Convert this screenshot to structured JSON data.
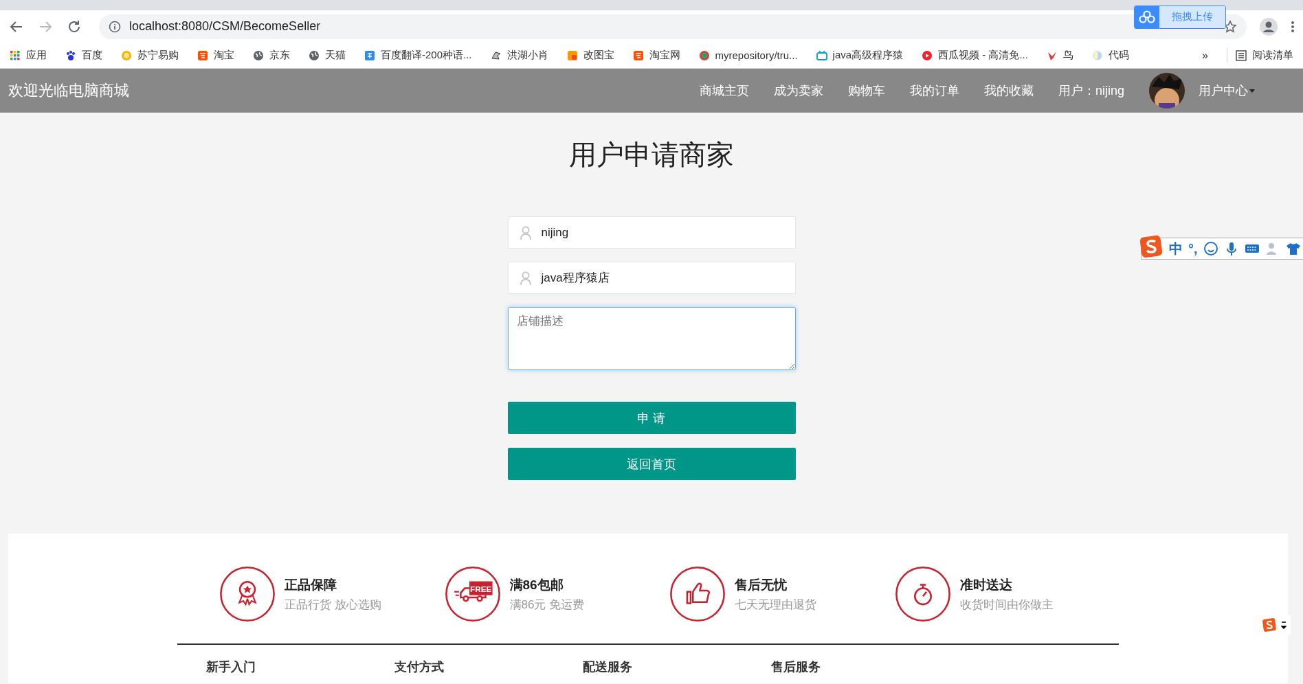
{
  "browser": {
    "address": "localhost:8080/CSM/BecomeSeller",
    "upload_button": "拖拽上传",
    "bookmarks": [
      {
        "label": "应用",
        "kind": "apps"
      },
      {
        "label": "百度",
        "kind": "paw"
      },
      {
        "label": "苏宁易购",
        "kind": "lion"
      },
      {
        "label": "淘宝",
        "kind": "tao"
      },
      {
        "label": "京东",
        "kind": "globe"
      },
      {
        "label": "天猫",
        "kind": "globe"
      },
      {
        "label": "百度翻译-200种语...",
        "kind": "translate"
      },
      {
        "label": "洪湖小肖",
        "kind": "bird"
      },
      {
        "label": "改图宝",
        "kind": "square"
      },
      {
        "label": "淘宝网",
        "kind": "tao"
      },
      {
        "label": "myrepository/tru...",
        "kind": "swirl"
      },
      {
        "label": "java高级程序猿",
        "kind": "tv"
      },
      {
        "label": "西瓜视频 - 高清免...",
        "kind": "play"
      },
      {
        "label": "鸟",
        "kind": "bird2"
      },
      {
        "label": "代码",
        "kind": "moon"
      }
    ],
    "more": "»",
    "reading_list": "阅读清单"
  },
  "navbar": {
    "brand": "欢迎光临电脑商城",
    "links": [
      "商城主页",
      "成为卖家",
      "购物车",
      "我的订单",
      "我的收藏",
      "用户：nijing"
    ],
    "user_menu": "用户中心"
  },
  "form": {
    "title": "用户申请商家",
    "fields": [
      {
        "value": "nijing"
      },
      {
        "value": "java程序猿店"
      }
    ],
    "description": {
      "placeholder": "店铺描述",
      "focused": true
    },
    "buttons": [
      "申 请",
      "返回首页"
    ]
  },
  "features": [
    {
      "kind": "medal",
      "title": "正品保障",
      "subtitle": "正品行货 放心选购"
    },
    {
      "kind": "truck",
      "icon_text": "FREE",
      "title": "满86包邮",
      "subtitle": "满86元 免运费"
    },
    {
      "kind": "thumb",
      "title": "售后无忧",
      "subtitle": "七天无理由退货"
    },
    {
      "kind": "timer",
      "title": "准时送达",
      "subtitle": "收货时间由你做主"
    }
  ],
  "footer_columns": [
    "新手入门",
    "支付方式",
    "配送服务",
    "售后服务"
  ],
  "ime_toolbar": {
    "mode": "中",
    "punctuation": "°,"
  }
}
